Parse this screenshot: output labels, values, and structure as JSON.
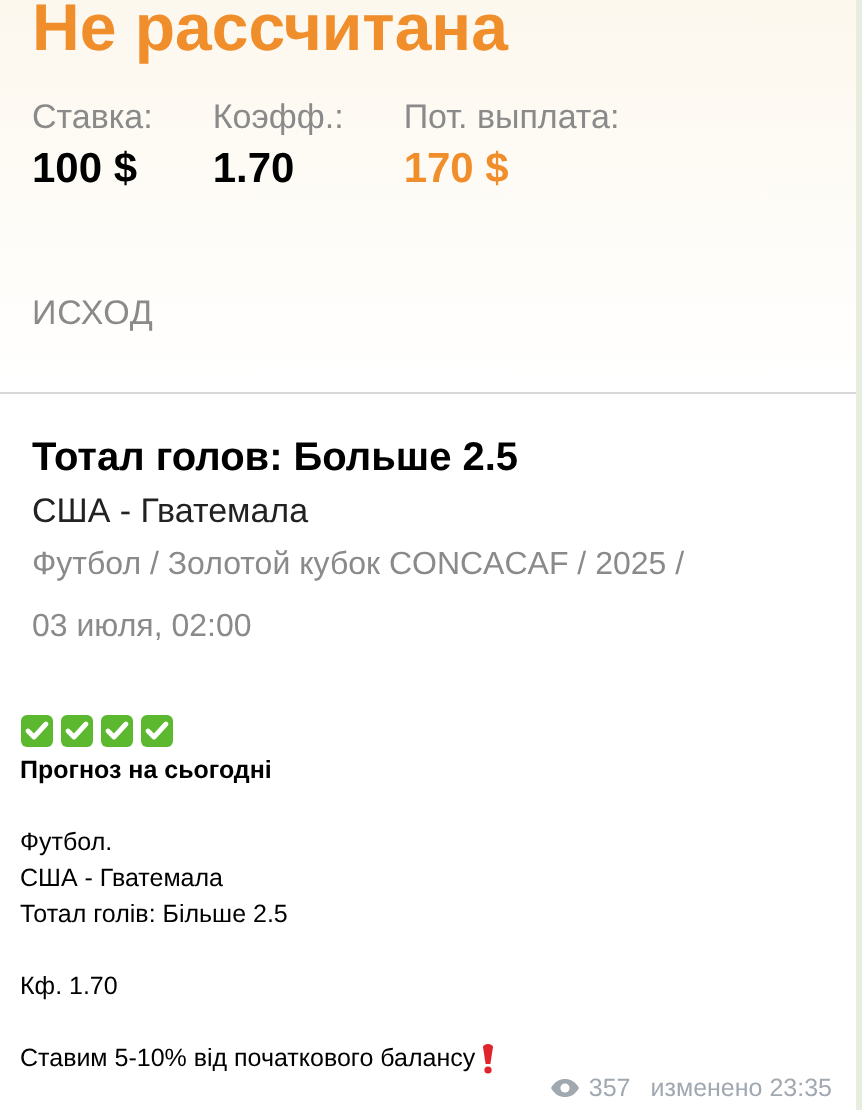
{
  "bet_slip": {
    "status": "Не рассчитана",
    "stats": [
      {
        "label": "Ставка:",
        "value": "100 $",
        "highlight": false
      },
      {
        "label": "Коэфф.:",
        "value": "1.70",
        "highlight": false
      },
      {
        "label": "Пот. выплата:",
        "value": "170 $",
        "highlight": true
      }
    ],
    "section_label": "ИСХОД",
    "outcome": {
      "title": "Тотал голов: Больше 2.5",
      "match": "США - Гватемала",
      "category": "Футбол / Золотой кубок CONCACAF / 2025 /",
      "date": "03 июля, 02:00"
    }
  },
  "message": {
    "check_marks": [
      {
        "kind": "check"
      },
      {
        "kind": "check"
      },
      {
        "kind": "check"
      },
      {
        "kind": "check"
      }
    ],
    "title": "Прогноз на сьогодні",
    "lines": [
      {
        "kind": "text",
        "text": "Футбол."
      },
      {
        "kind": "text",
        "text": "США - Гватемала"
      },
      {
        "kind": "text",
        "text": "Тотал голів: Більше 2.5"
      },
      {
        "kind": "gap"
      },
      {
        "kind": "text",
        "text": "Кф. 1.70"
      },
      {
        "kind": "gap"
      },
      {
        "kind": "alert",
        "text": "Ставим 5-10% від початкового балансу"
      }
    ],
    "views": "357",
    "edited": "изменено 23:35"
  }
}
